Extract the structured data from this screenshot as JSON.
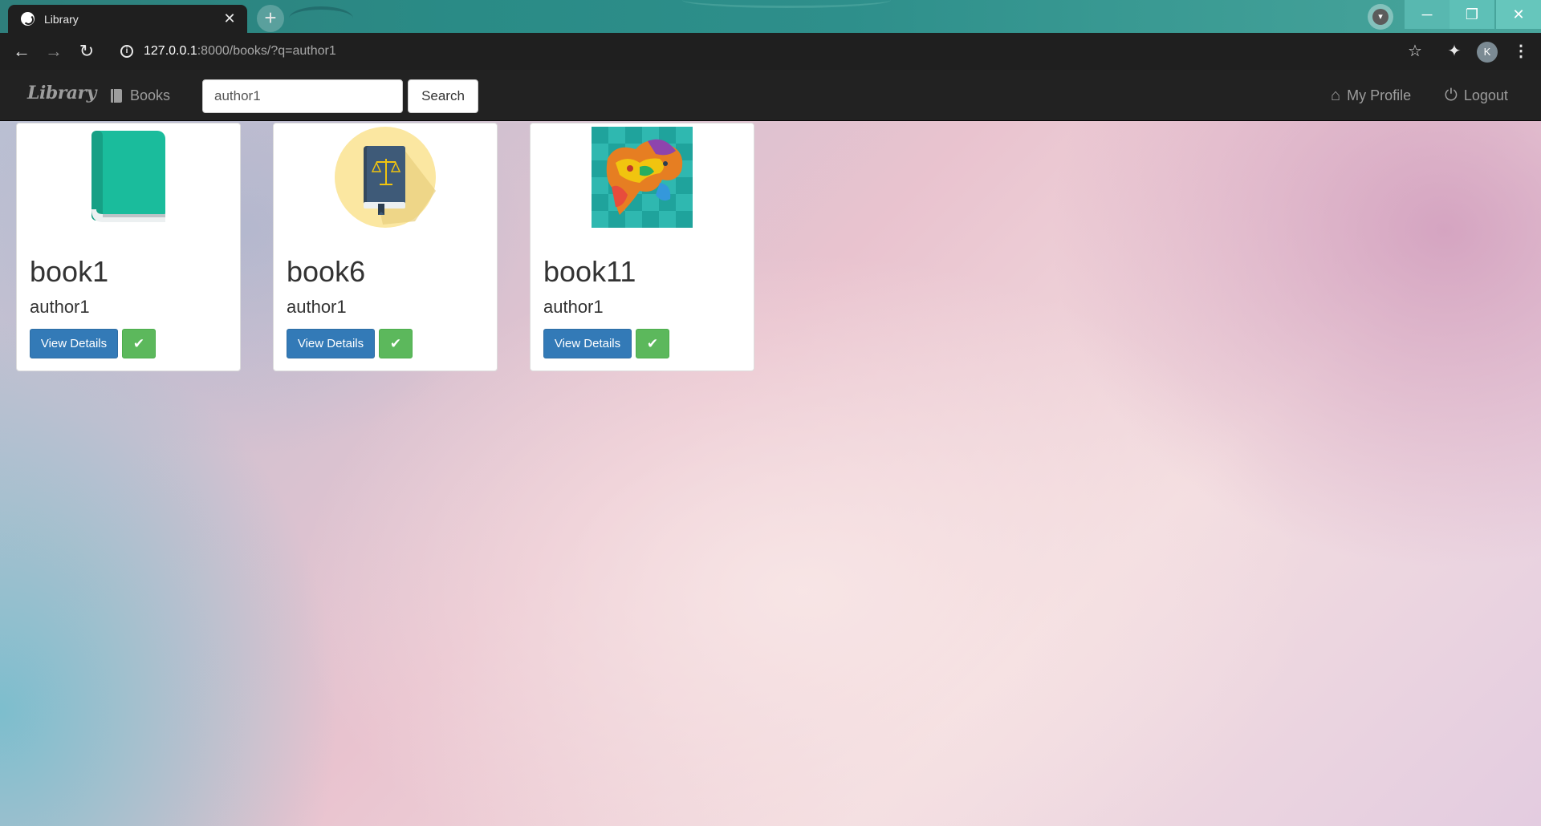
{
  "browser": {
    "tab_title": "Library",
    "tab_close": "✕",
    "new_tab": "+",
    "url_host": "127.0.0.1",
    "url_path": ":8000/books/?q=author1",
    "profile_initial": "K",
    "window_buttons": {
      "minimize": "─",
      "maximize": "❐",
      "close": "✕"
    }
  },
  "navbar": {
    "brand": "Library",
    "books_link": "Books",
    "search": {
      "value": "author1",
      "button": "Search"
    },
    "my_profile": "My Profile",
    "logout": "Logout"
  },
  "books": [
    {
      "title": "book1",
      "author": "author1",
      "cover": "teal-book-icon",
      "details_label": "View Details"
    },
    {
      "title": "book6",
      "author": "author1",
      "cover": "law-book-icon",
      "details_label": "View Details"
    },
    {
      "title": "book11",
      "author": "author1",
      "cover": "colorful-map-image",
      "details_label": "View Details"
    }
  ],
  "colors": {
    "primary": "#337ab7",
    "success": "#5cb85c",
    "navbar": "#222222"
  }
}
